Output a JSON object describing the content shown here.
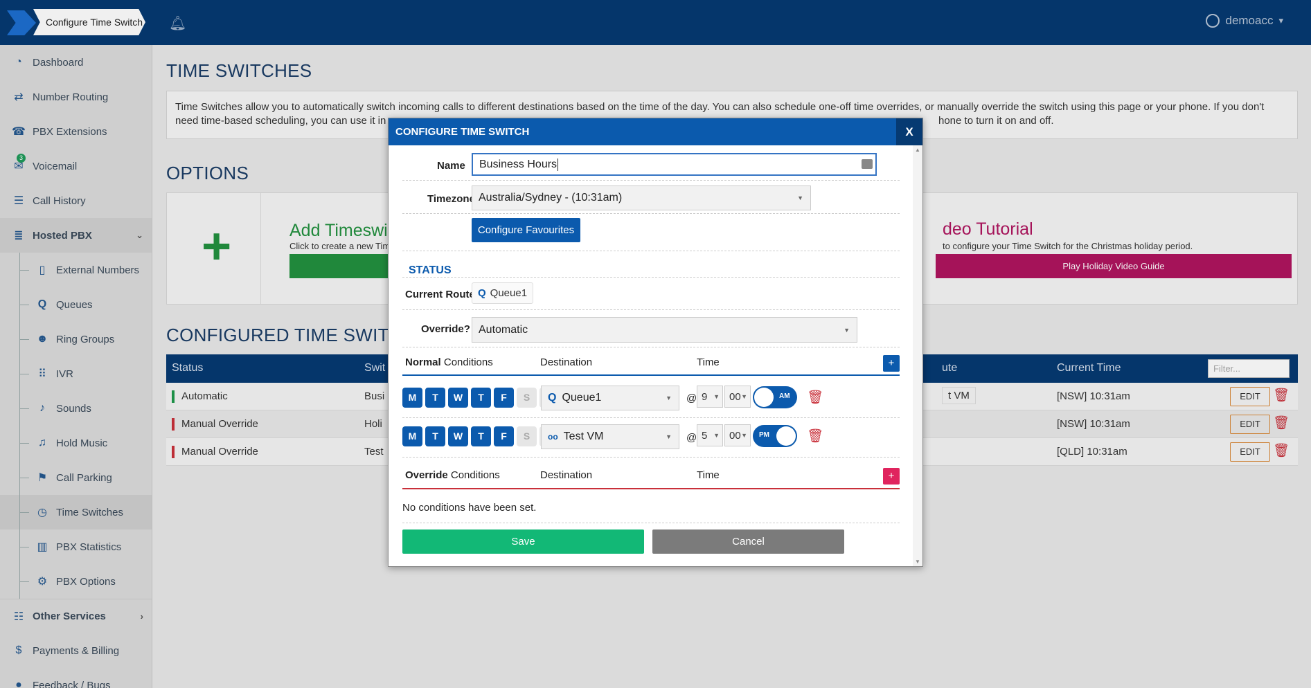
{
  "topbar": {
    "breadcrumb": "Configure Time Switch",
    "bell_icon": "bell-icon",
    "user_name": "demoacc",
    "user_caret": "▾"
  },
  "sidebar": {
    "items": [
      {
        "label": "Dashboard",
        "icon": "speedometer-icon",
        "glyph": "◔"
      },
      {
        "label": "Number Routing",
        "icon": "routing-icon",
        "glyph": "⇄"
      },
      {
        "label": "PBX Extensions",
        "icon": "phone-icon",
        "glyph": "☎"
      },
      {
        "label": "Voicemail",
        "icon": "voicemail-icon",
        "glyph": "✉",
        "badge": "3"
      },
      {
        "label": "Call History",
        "icon": "list-icon",
        "glyph": "☰"
      },
      {
        "label": "Hosted PBX",
        "icon": "database-icon",
        "glyph": "≣"
      },
      {
        "label": "External Numbers",
        "icon": "mobile-icon",
        "glyph": "▯"
      },
      {
        "label": "Queues",
        "icon": "queue-icon",
        "glyph": "Q"
      },
      {
        "label": "Ring Groups",
        "icon": "group-icon",
        "glyph": "☻"
      },
      {
        "label": "IVR",
        "icon": "keypad-icon",
        "glyph": "⠿"
      },
      {
        "label": "Sounds",
        "icon": "speaker-icon",
        "glyph": "♪"
      },
      {
        "label": "Hold Music",
        "icon": "music-icon",
        "glyph": "♫"
      },
      {
        "label": "Call Parking",
        "icon": "parking-icon",
        "glyph": "⚑"
      },
      {
        "label": "Time Switches",
        "icon": "clock-icon",
        "glyph": "◷"
      },
      {
        "label": "PBX Statistics",
        "icon": "bar-chart-icon",
        "glyph": "▥"
      },
      {
        "label": "PBX Options",
        "icon": "gear-icon",
        "glyph": "⚙"
      },
      {
        "label": "Other Services",
        "icon": "sliders-icon",
        "glyph": "☷"
      },
      {
        "label": "Payments & Billing",
        "icon": "dollar-icon",
        "glyph": "$"
      },
      {
        "label": "Feedback / Bugs",
        "icon": "chat-icon",
        "glyph": "●"
      }
    ],
    "expand_down": "⌄",
    "expand_right": "›"
  },
  "main": {
    "title": "TIME SWITCHES",
    "info": "Time Switches allow you to automatically switch incoming calls to different destinations based on the time of the day. You can also schedule one-off time overrides, or manually override the switch using this page or your phone. If you don't need time-based scheduling, you can use it in",
    "info_tail": "hone to turn it on and off.",
    "options_title": "OPTIONS",
    "add_title": "Add Timeswitc",
    "add_sub": "Click to create a new Time",
    "video_title": "deo Tutorial",
    "video_sub": "to configure your Time Switch for the Christmas holiday period.",
    "video_button": "Play Holiday Video Guide",
    "configured_title": "CONFIGURED TIME SWITCH",
    "table": {
      "headers": {
        "status": "Status",
        "switch": "Swit",
        "route": "ute",
        "current_time": "Current Time"
      },
      "filter_placeholder": "Filter...",
      "rows": [
        {
          "status": "Automatic",
          "switch": "Busi",
          "route": "t VM",
          "time": "[NSW] 10:31am",
          "edit": "EDIT"
        },
        {
          "status": "Manual Override",
          "switch": "Holi",
          "route": "",
          "time": "[NSW] 10:31am",
          "edit": "EDIT"
        },
        {
          "status": "Manual Override",
          "switch": "Test",
          "route": "",
          "time": "[QLD] 10:31am",
          "edit": "EDIT"
        }
      ]
    }
  },
  "modal": {
    "title": "CONFIGURE TIME SWITCH",
    "close": "X",
    "name_label": "Name",
    "name_value": "Business Hours",
    "timezone_label": "Timezone",
    "timezone_value": "Australia/Sydney - (10:31am)",
    "favourites_button": "Configure Favourites",
    "status_title": "STATUS",
    "current_route_label": "Current Route",
    "current_route_value": "Queue1",
    "override_label": "Override?",
    "override_value": "Automatic",
    "normal": {
      "title_bold": "Normal",
      "title_rest": " Conditions",
      "destination_col": "Destination",
      "time_col": "Time",
      "add": "+",
      "rows": [
        {
          "days": [
            "M",
            "T",
            "W",
            "T",
            "F",
            "S",
            "S"
          ],
          "active": [
            true,
            true,
            true,
            true,
            true,
            false,
            false
          ],
          "destination": "Queue1",
          "dest_icon": "queue-icon",
          "dest_glyph": "Q",
          "hour": "9",
          "minute": "00",
          "ampm": "AM"
        },
        {
          "days": [
            "M",
            "T",
            "W",
            "T",
            "F",
            "S",
            "S"
          ],
          "active": [
            true,
            true,
            true,
            true,
            true,
            false,
            false
          ],
          "destination": "Test VM",
          "dest_icon": "voicemail-icon",
          "dest_glyph": "oo",
          "hour": "5",
          "minute": "00",
          "ampm": "PM"
        }
      ]
    },
    "at_symbol": "@",
    "override": {
      "title_bold": "Override",
      "title_rest": " Conditions",
      "destination_col": "Destination",
      "time_col": "Time",
      "add": "+",
      "empty": "No conditions have been set."
    },
    "save": "Save",
    "cancel": "Cancel"
  },
  "colors": {
    "topbar": "#063a72",
    "primary": "#0b5aad",
    "success": "#12b876",
    "danger": "#c9303a",
    "magenta": "#b0155f"
  }
}
